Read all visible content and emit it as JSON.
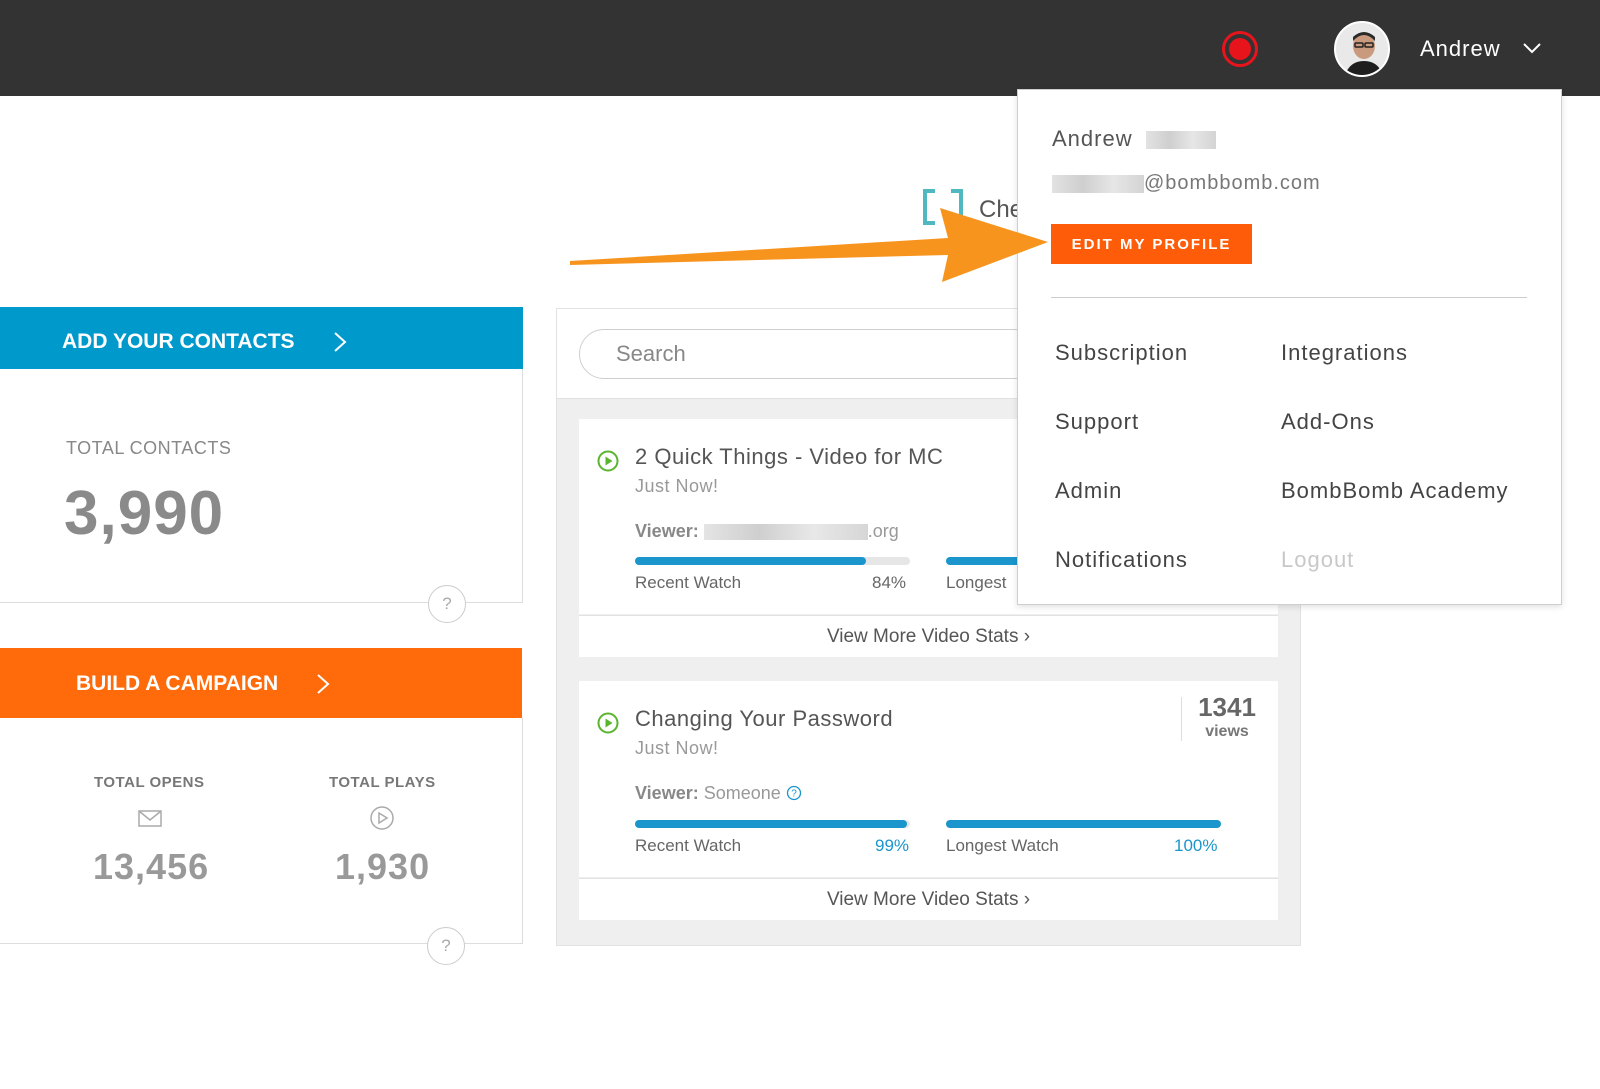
{
  "header": {
    "user_name": "Andrew",
    "avatar_icon": "user-avatar",
    "record_icon": "record-icon",
    "chevron_icon": "chevron-down-icon"
  },
  "check": {
    "text": "Che"
  },
  "left": {
    "add_contacts_label": "ADD YOUR CONTACTS",
    "total_contacts_label": "TOTAL CONTACTS",
    "total_contacts_value": "3,990",
    "help": "?",
    "build_campaign_label": "BUILD A CAMPAIGN",
    "total_opens_label": "TOTAL OPENS",
    "total_opens_value": "13,456",
    "total_plays_label": "TOTAL PLAYS",
    "total_plays_value": "1,930"
  },
  "search": {
    "placeholder": "Search"
  },
  "videos": [
    {
      "title": "2 Quick Things - Video for MC",
      "time": "Just Now!",
      "viewer_label": "Viewer:",
      "viewer_value_suffix": ".org",
      "recent_label": "Recent Watch",
      "recent_pct": "84%",
      "recent_value": 0.84,
      "longest_label": "Longest",
      "more_label": "View More Video Stats ›"
    },
    {
      "title": "Changing Your Password",
      "time": "Just Now!",
      "viewer_label": "Viewer:",
      "viewer_value": "Someone",
      "views_count": "1341",
      "views_label": "views",
      "recent_label": "Recent Watch",
      "recent_pct": "99%",
      "recent_value": 0.99,
      "longest_label": "Longest Watch",
      "longest_pct": "100%",
      "longest_value": 1.0,
      "more_label": "View More Video Stats ›"
    }
  ],
  "dropdown": {
    "name": "Andrew",
    "email_suffix": "@bombbomb.com",
    "edit_profile_label": "EDIT MY PROFILE",
    "items": [
      {
        "label": "Subscription"
      },
      {
        "label": "Integrations"
      },
      {
        "label": "Support"
      },
      {
        "label": "Add-Ons"
      },
      {
        "label": "Admin"
      },
      {
        "label": "BombBomb Academy"
      },
      {
        "label": "Notifications"
      },
      {
        "label": "Logout"
      }
    ]
  },
  "colors": {
    "topbar": "#333333",
    "blue": "#0099cc",
    "orange": "#ff6b0a",
    "edit_button": "#ff5c0a",
    "arrow": "#f7941d",
    "record": "#e8141c",
    "progress": "#1a96cc"
  }
}
